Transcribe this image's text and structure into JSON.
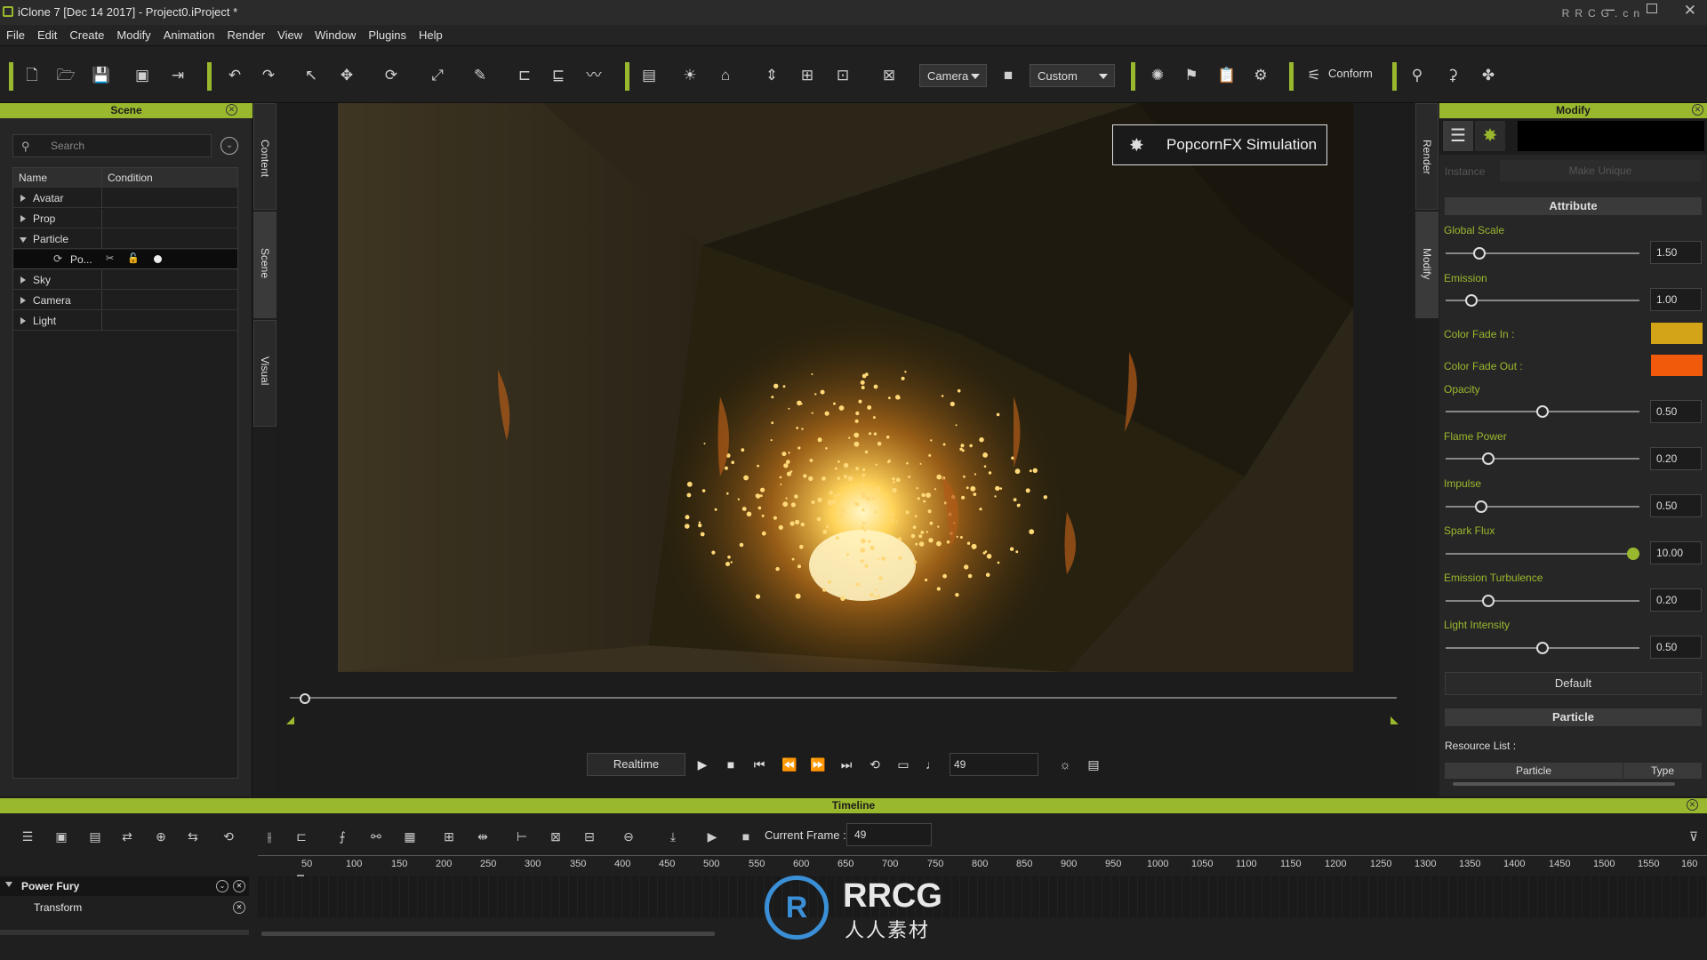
{
  "window": {
    "title": "iClone 7 [Dec 14 2017] - Project0.iProject *",
    "watermark": "RRCG.cn"
  },
  "menu": [
    "File",
    "Edit",
    "Create",
    "Modify",
    "Animation",
    "Render",
    "View",
    "Window",
    "Plugins",
    "Help"
  ],
  "toolbar": {
    "camera_select": "Camera",
    "view_select": "Custom",
    "conform_label": "Conform"
  },
  "scene_panel": {
    "title": "Scene",
    "search_placeholder": "Search",
    "columns": [
      "Name",
      "Condition"
    ],
    "items": [
      {
        "label": "Avatar",
        "expanded": false
      },
      {
        "label": "Prop",
        "expanded": false
      },
      {
        "label": "Particle",
        "expanded": true
      },
      {
        "label": "Po...",
        "child": true
      },
      {
        "label": "Sky",
        "expanded": false
      },
      {
        "label": "Camera",
        "expanded": false
      },
      {
        "label": "Light",
        "expanded": false
      }
    ],
    "side_tabs": [
      "Content",
      "Scene",
      "Visual"
    ]
  },
  "viewport": {
    "overlay_button": "PopcornFX Simulation"
  },
  "playback": {
    "mode": "Realtime",
    "frame": "49"
  },
  "modify_panel": {
    "title": "Modify",
    "side_tabs": [
      "Render",
      "Modify"
    ],
    "instance_label": "Instance",
    "make_unique": "Make Unique",
    "attribute_section": "Attribute",
    "params": [
      {
        "label": "Global Scale",
        "value": "1.50",
        "level": 0.15
      },
      {
        "label": "Emission",
        "value": "1.00",
        "level": 0.11
      },
      {
        "label": "Opacity",
        "value": "0.50",
        "level": 0.5
      },
      {
        "label": "Flame Power",
        "value": "0.20",
        "level": 0.2
      },
      {
        "label": "Impulse",
        "value": "0.50",
        "level": 0.16
      },
      {
        "label": "Spark Flux",
        "value": "10.00",
        "level": 1.0
      },
      {
        "label": "Emission Turbulence",
        "value": "0.20",
        "level": 0.2
      },
      {
        "label": "Light Intensity",
        "value": "0.50",
        "level": 0.5
      }
    ],
    "color_fade_in": {
      "label": "Color Fade In :",
      "color": "#d4a418"
    },
    "color_fade_out": {
      "label": "Color Fade Out :",
      "color": "#f05a0a"
    },
    "default_button": "Default",
    "particle_section": "Particle",
    "resource_list_label": "Resource List :",
    "resource_columns": [
      "Particle",
      "Type"
    ]
  },
  "timeline": {
    "title": "Timeline",
    "current_frame_label": "Current Frame :",
    "current_frame": "49",
    "ruler": [
      "50",
      "100",
      "150",
      "200",
      "250",
      "300",
      "350",
      "400",
      "450",
      "500",
      "550",
      "600",
      "650",
      "700",
      "750",
      "800",
      "850",
      "900",
      "950",
      "1000",
      "1050",
      "1100",
      "1150",
      "1200",
      "1250",
      "1300",
      "1350",
      "1400",
      "1450",
      "1500",
      "1550",
      "160"
    ],
    "tracks": [
      {
        "label": "Power Fury"
      },
      {
        "label": "Transform"
      }
    ],
    "watermark": {
      "brand": "RRCG",
      "sub": "人人素材"
    }
  }
}
